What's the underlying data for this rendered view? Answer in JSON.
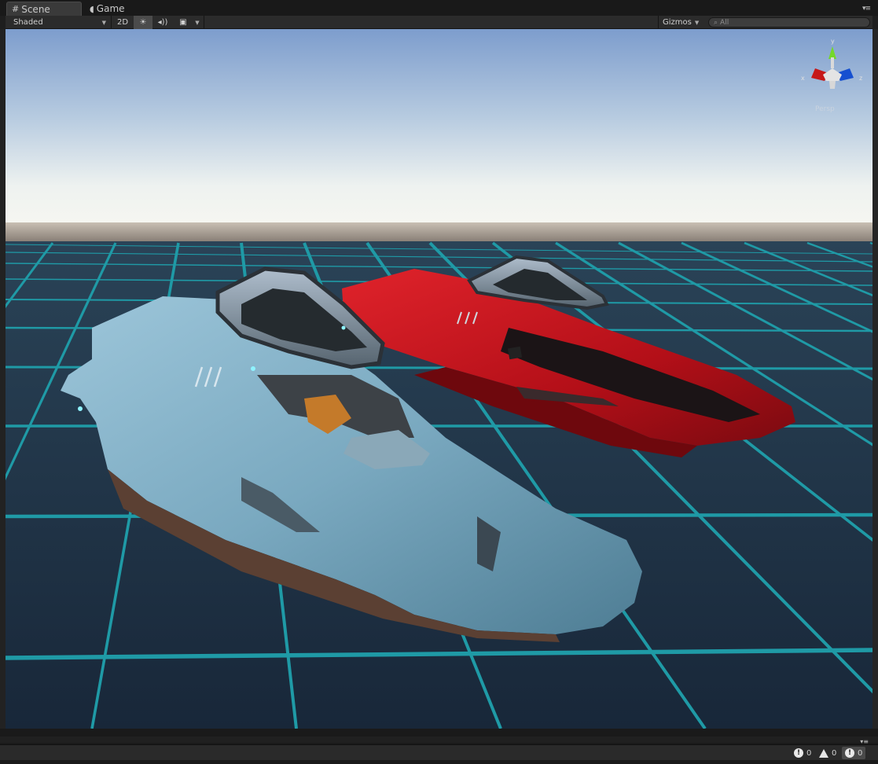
{
  "tabs": [
    {
      "label": "Scene",
      "icon": "hash-icon"
    },
    {
      "label": "Game",
      "icon": "pacman-icon"
    }
  ],
  "toolbar": {
    "shading_mode": "Shaded",
    "mode_2d": "2D",
    "gizmos_label": "Gizmos",
    "search_placeholder": "All"
  },
  "axis_gizmo": {
    "x": "x",
    "y": "y",
    "z": "z",
    "persp_label": "Persp"
  },
  "console_counts": {
    "messages": "0",
    "warnings": "0",
    "errors": "0"
  },
  "colors": {
    "grid_line": "#1f9aa6",
    "ground": "#1b2a3c",
    "sky_top": "#7f9fcf",
    "horizon": "#f4f6f2",
    "blue_ship": "#7fb0c8",
    "red_ship": "#c8141c"
  }
}
